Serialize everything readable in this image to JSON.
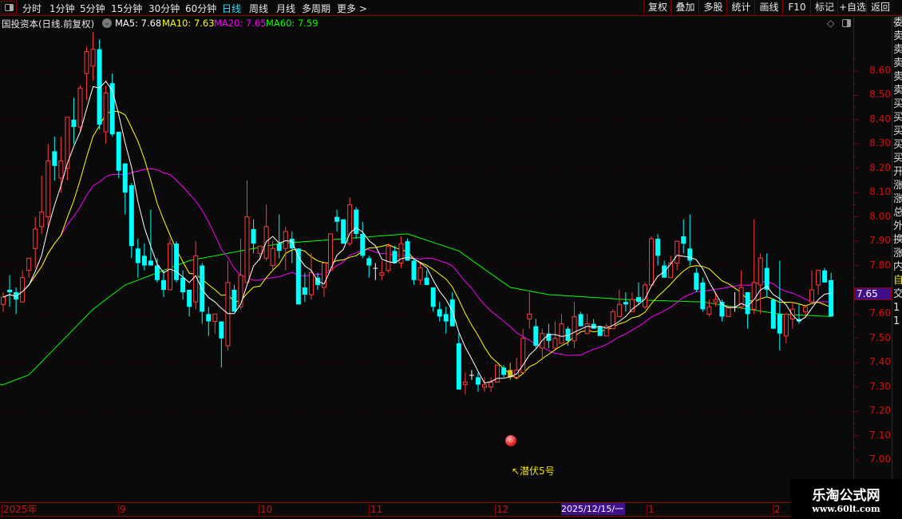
{
  "toolbar": {
    "periods": [
      "分时",
      "1分钟",
      "5分钟",
      "15分钟",
      "30分钟",
      "60分钟",
      "日线",
      "周线",
      "月线",
      "多周期",
      "更多 >"
    ],
    "active_period": "日线",
    "right_buttons": [
      "复权",
      "叠加",
      "多股",
      "统计",
      "画线",
      "F10",
      "标记",
      "+自选",
      "返回"
    ]
  },
  "info": {
    "title": "国投资本(日线.前复权)",
    "ma5": "MA5: 7.68",
    "ma10": "MA10: 7.63",
    "ma20": "MA20: 7.65",
    "ma60": "MA60: 7.59",
    "diamond_icon": "◇"
  },
  "colors": {
    "up": "#ff3b3b",
    "down": "#00ffff",
    "ma5": "#ffffff",
    "ma10": "#ffff00",
    "ma20": "#ff00ff",
    "ma60": "#00ff00",
    "grid": "#5a0000",
    "axis_text": "#d41010",
    "highlight": "#40108a"
  },
  "price_axis": {
    "labels": [
      "8.60",
      "8.50",
      "8.40",
      "8.30",
      "8.20",
      "8.10",
      "8.00",
      "7.90",
      "7.80",
      "7.60",
      "7.50",
      "7.40",
      "7.30",
      "7.20",
      "7.10",
      "7.00"
    ],
    "current_price": "7.65"
  },
  "right_column": [
    "委",
    "卖",
    "卖",
    "卖",
    "卖",
    "卖",
    "买",
    "买",
    "买",
    "买",
    "买",
    "开",
    "涨",
    "涨",
    "总",
    "外",
    "换",
    "涨",
    "内",
    "自",
    "交",
    "1",
    "1"
  ],
  "x_axis": {
    "labels": [
      "2025年",
      "9",
      "10",
      "11",
      "12",
      "1",
      "2"
    ],
    "crosshair_date": "2025/12/15/一"
  },
  "signal": {
    "label": "↖潜伏5号"
  },
  "watermark": {
    "name": "乐淘公式网",
    "url": "www.60lt.com"
  },
  "chart_data": {
    "type": "candlestick",
    "ylim": [
      7.0,
      8.6
    ],
    "grid": true,
    "highlighted_bar": 80,
    "ohlc": [
      [
        7.64,
        7.69,
        7.61,
        7.67
      ],
      [
        7.7,
        7.76,
        7.63,
        7.69
      ],
      [
        7.69,
        7.71,
        7.6,
        7.66
      ],
      [
        7.65,
        7.78,
        7.65,
        7.75
      ],
      [
        7.78,
        7.83,
        7.75,
        7.83
      ],
      [
        7.87,
        8.0,
        7.79,
        7.95
      ],
      [
        7.96,
        8.17,
        7.93,
        8.02
      ],
      [
        8.0,
        8.3,
        7.96,
        8.23
      ],
      [
        8.27,
        8.33,
        8.15,
        8.21
      ],
      [
        8.16,
        8.33,
        8.1,
        8.23
      ],
      [
        8.2,
        8.41,
        8.15,
        8.41
      ],
      [
        8.4,
        8.49,
        8.3,
        8.37
      ],
      [
        8.37,
        8.54,
        8.35,
        8.53
      ],
      [
        8.59,
        8.7,
        8.48,
        8.68
      ],
      [
        8.62,
        8.76,
        8.56,
        8.69
      ],
      [
        8.69,
        8.73,
        8.36,
        8.38
      ],
      [
        8.35,
        8.54,
        8.3,
        8.51
      ],
      [
        8.55,
        8.59,
        8.33,
        8.34
      ],
      [
        8.35,
        8.35,
        8.16,
        8.19
      ],
      [
        8.22,
        8.22,
        8.01,
        8.1
      ],
      [
        8.13,
        8.14,
        7.83,
        7.88
      ],
      [
        7.87,
        7.91,
        7.75,
        7.81
      ],
      [
        7.84,
        7.89,
        7.78,
        7.8
      ],
      [
        7.82,
        8.03,
        7.8,
        7.8
      ],
      [
        7.8,
        7.83,
        7.73,
        7.74
      ],
      [
        7.74,
        7.78,
        7.67,
        7.7
      ],
      [
        7.7,
        7.91,
        7.7,
        7.89
      ],
      [
        7.89,
        7.9,
        7.73,
        7.74
      ],
      [
        7.75,
        7.78,
        7.66,
        7.69
      ],
      [
        7.7,
        7.7,
        7.59,
        7.63
      ],
      [
        7.65,
        7.9,
        7.62,
        7.84
      ],
      [
        7.8,
        7.81,
        7.56,
        7.61
      ],
      [
        7.6,
        7.63,
        7.51,
        7.57
      ],
      [
        7.57,
        7.6,
        7.52,
        7.6
      ],
      [
        7.57,
        7.57,
        7.38,
        7.5
      ],
      [
        7.47,
        7.82,
        7.45,
        7.73
      ],
      [
        7.7,
        7.72,
        7.61,
        7.61
      ],
      [
        7.63,
        7.91,
        7.62,
        7.76
      ],
      [
        7.73,
        8.15,
        7.73,
        8.0
      ],
      [
        7.95,
        7.99,
        7.85,
        7.89
      ],
      [
        7.85,
        7.88,
        7.82,
        7.88
      ],
      [
        7.83,
        8.05,
        7.82,
        7.96
      ],
      [
        7.8,
        7.9,
        7.78,
        7.87
      ],
      [
        7.89,
        8.01,
        7.83,
        7.86
      ],
      [
        7.87,
        7.96,
        7.78,
        7.94
      ],
      [
        7.91,
        7.94,
        7.81,
        7.87
      ],
      [
        7.87,
        7.87,
        7.64,
        7.64
      ],
      [
        7.71,
        7.77,
        7.65,
        7.68
      ],
      [
        7.68,
        7.85,
        7.66,
        7.77
      ],
      [
        7.75,
        7.77,
        7.7,
        7.72
      ],
      [
        7.71,
        7.81,
        7.67,
        7.81
      ],
      [
        7.78,
        7.93,
        7.78,
        7.93
      ],
      [
        8.0,
        8.03,
        7.94,
        7.98
      ],
      [
        7.99,
        7.99,
        7.89,
        7.89
      ],
      [
        7.89,
        8.08,
        7.88,
        8.05
      ],
      [
        8.03,
        8.04,
        7.91,
        7.93
      ],
      [
        7.93,
        7.98,
        7.83,
        7.84
      ],
      [
        7.83,
        7.84,
        7.75,
        7.8
      ],
      [
        7.79,
        7.81,
        7.74,
        7.79
      ],
      [
        7.76,
        7.82,
        7.74,
        7.77
      ],
      [
        7.78,
        7.89,
        7.77,
        7.88
      ],
      [
        7.86,
        7.88,
        7.81,
        7.81
      ],
      [
        7.81,
        7.92,
        7.79,
        7.89
      ],
      [
        7.9,
        7.91,
        7.82,
        7.82
      ],
      [
        7.82,
        7.83,
        7.72,
        7.74
      ],
      [
        7.74,
        7.81,
        7.72,
        7.79
      ],
      [
        7.75,
        7.78,
        7.72,
        7.72
      ],
      [
        7.71,
        7.71,
        7.61,
        7.63
      ],
      [
        7.62,
        7.65,
        7.57,
        7.59
      ],
      [
        7.6,
        7.63,
        7.52,
        7.57
      ],
      [
        7.66,
        7.69,
        7.55,
        7.55
      ],
      [
        7.48,
        7.52,
        7.29,
        7.29
      ],
      [
        7.31,
        7.36,
        7.27,
        7.32
      ],
      [
        7.35,
        7.37,
        7.33,
        7.35
      ],
      [
        7.34,
        7.36,
        7.28,
        7.31
      ],
      [
        7.3,
        7.34,
        7.28,
        7.31
      ],
      [
        7.3,
        7.34,
        7.28,
        7.32
      ],
      [
        7.32,
        7.39,
        7.32,
        7.39
      ],
      [
        7.38,
        7.39,
        7.34,
        7.35
      ],
      [
        7.37,
        7.4,
        7.33,
        7.34
      ],
      [
        7.34,
        7.42,
        7.34,
        7.37
      ],
      [
        7.36,
        7.54,
        7.36,
        7.5
      ],
      [
        7.58,
        7.69,
        7.54,
        7.6
      ],
      [
        7.55,
        7.58,
        7.46,
        7.47
      ],
      [
        7.46,
        7.54,
        7.41,
        7.52
      ],
      [
        7.52,
        7.56,
        7.46,
        7.49
      ],
      [
        7.46,
        7.57,
        7.46,
        7.5
      ],
      [
        7.48,
        7.6,
        7.48,
        7.56
      ],
      [
        7.54,
        7.55,
        7.47,
        7.49
      ],
      [
        7.49,
        7.65,
        7.46,
        7.59
      ],
      [
        7.6,
        7.61,
        7.55,
        7.55
      ],
      [
        7.52,
        7.6,
        7.52,
        7.56
      ],
      [
        7.56,
        7.58,
        7.54,
        7.54
      ],
      [
        7.55,
        7.55,
        7.51,
        7.51
      ],
      [
        7.51,
        7.56,
        7.51,
        7.55
      ],
      [
        7.54,
        7.62,
        7.54,
        7.61
      ],
      [
        7.59,
        7.7,
        7.59,
        7.64
      ],
      [
        7.65,
        7.69,
        7.61,
        7.64
      ],
      [
        7.61,
        7.69,
        7.61,
        7.66
      ],
      [
        7.67,
        7.73,
        7.64,
        7.65
      ],
      [
        7.63,
        7.73,
        7.62,
        7.72
      ],
      [
        7.72,
        7.92,
        7.72,
        7.91
      ],
      [
        7.91,
        7.93,
        7.8,
        7.84
      ],
      [
        7.8,
        7.82,
        7.75,
        7.75
      ],
      [
        7.75,
        7.84,
        7.75,
        7.81
      ],
      [
        7.81,
        7.9,
        7.78,
        7.9
      ],
      [
        7.92,
        7.99,
        7.85,
        7.89
      ],
      [
        7.87,
        8.01,
        7.8,
        7.82
      ],
      [
        7.77,
        7.79,
        7.69,
        7.7
      ],
      [
        7.73,
        7.75,
        7.61,
        7.62
      ],
      [
        7.6,
        7.66,
        7.59,
        7.63
      ],
      [
        7.65,
        7.69,
        7.63,
        7.66
      ],
      [
        7.65,
        7.66,
        7.57,
        7.59
      ],
      [
        7.59,
        7.63,
        7.59,
        7.63
      ],
      [
        7.63,
        7.69,
        7.61,
        7.63
      ],
      [
        7.63,
        7.78,
        7.62,
        7.71
      ],
      [
        7.69,
        7.69,
        7.54,
        7.6
      ],
      [
        7.62,
        7.99,
        7.6,
        7.73
      ],
      [
        7.72,
        7.85,
        7.6,
        7.83
      ],
      [
        7.79,
        7.85,
        7.67,
        7.7
      ],
      [
        7.66,
        7.66,
        7.54,
        7.54
      ],
      [
        7.6,
        7.82,
        7.45,
        7.52
      ],
      [
        7.51,
        7.6,
        7.48,
        7.6
      ],
      [
        7.58,
        7.65,
        7.54,
        7.62
      ],
      [
        7.58,
        7.64,
        7.56,
        7.57
      ],
      [
        7.61,
        7.64,
        7.59,
        7.63
      ],
      [
        7.65,
        7.78,
        7.64,
        7.7
      ],
      [
        7.72,
        7.78,
        7.68,
        7.78
      ],
      [
        7.78,
        7.79,
        7.73,
        7.73
      ],
      [
        7.74,
        7.77,
        7.59,
        7.59
      ]
    ],
    "ma60": [
      {
        "bar": 1,
        "value": 7.31
      },
      {
        "bar": 5,
        "value": 7.35
      },
      {
        "bar": 15,
        "value": 7.62
      },
      {
        "bar": 20,
        "value": 7.72
      },
      {
        "bar": 30,
        "value": 7.82
      },
      {
        "bar": 44,
        "value": 7.89
      },
      {
        "bar": 64,
        "value": 7.93
      },
      {
        "bar": 72,
        "value": 7.86
      },
      {
        "bar": 80,
        "value": 7.71
      },
      {
        "bar": 86,
        "value": 7.68
      },
      {
        "bar": 98,
        "value": 7.66
      },
      {
        "bar": 110,
        "value": 7.65
      },
      {
        "bar": 122,
        "value": 7.6
      },
      {
        "bar": 130,
        "value": 7.59
      }
    ]
  }
}
